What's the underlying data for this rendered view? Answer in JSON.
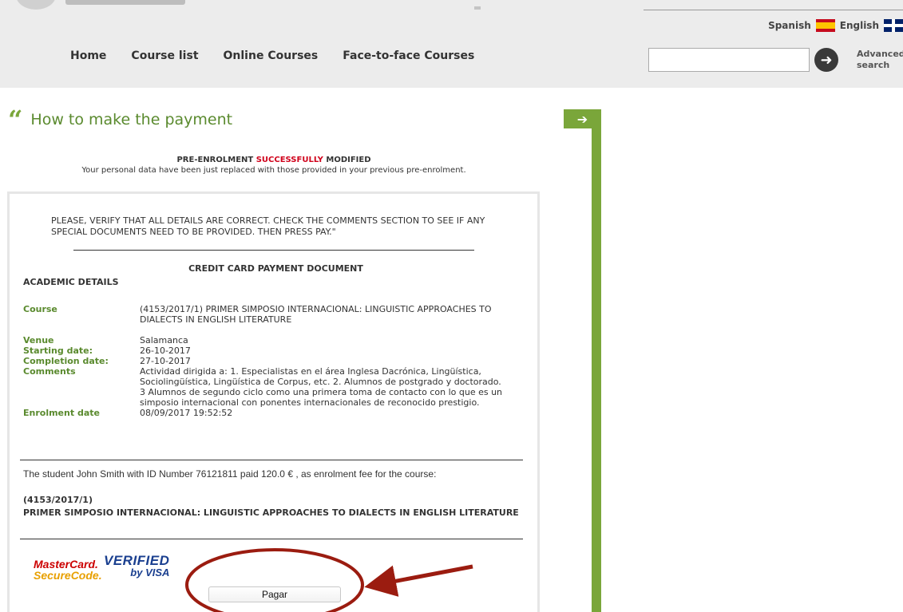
{
  "header": {
    "languages": [
      {
        "label": "Spanish",
        "flag": "spain-flag-icon"
      },
      {
        "label": "English",
        "flag": "uk-flag-icon"
      }
    ],
    "nav": [
      "Home",
      "Course list",
      "Online Courses",
      "Face-to-face Courses"
    ],
    "search": {
      "value": "",
      "advanced_label_line1": "Advanced",
      "advanced_label_line2": "search"
    }
  },
  "page_title": "How to make the payment",
  "confirmation": {
    "prefix": "PRE-ENROLMENT ",
    "highlight": "SUCCESSFULLY",
    "suffix": " MODIFIED",
    "message": "Your personal data have been just replaced with those provided in your previous pre-enrolment."
  },
  "document": {
    "verify_text": "PLEASE, VERIFY THAT ALL DETAILS ARE CORRECT. CHECK THE COMMENTS SECTION TO SEE IF ANY SPECIAL DOCUMENTS NEED TO BE PROVIDED. THEN PRESS PAY.\"",
    "title": "CREDIT CARD PAYMENT DOCUMENT",
    "section": "ACADEMIC DETAILS",
    "details": [
      {
        "label": "Course",
        "value": "(4153/2017/1) PRIMER SIMPOSIO INTERNACIONAL: LINGUISTIC APPROACHES TO DIALECTS IN ENGLISH LITERATURE"
      },
      {
        "label": "Venue",
        "value": "Salamanca"
      },
      {
        "label": "Starting date:",
        "value": "26-10-2017"
      },
      {
        "label": "Completion date:",
        "value": "27-10-2017"
      },
      {
        "label": "Comments",
        "value": "Actividad dirigida a: 1. Especialistas en el área Inglesa Dacrónica, Lingüística, Sociolingüística, Lingüística de Corpus, etc. 2. Alumnos de postgrado y doctorado. 3 Alumnos de segundo ciclo como una primera toma de contacto con lo que es un simposio internacional con ponentes internacionales de reconocido prestigio."
      },
      {
        "label": "Enrolment date",
        "value": "08/09/2017 19:52:52"
      }
    ],
    "student_line": "The student John Smith with ID Number 76121811 paid 120.0 € , as enrolment fee for the course:",
    "course_code": "(4153/2017/1)",
    "course_name": "PRIMER SIMPOSIO INTERNACIONAL: LINGUISTIC APPROACHES TO DIALECTS IN ENGLISH LITERATURE",
    "mastercard_line1": "MasterCard.",
    "mastercard_line2": "SecureCode.",
    "visa_line1": "VERIFIED",
    "visa_line2": "by VISA",
    "pay_button": "Pagar"
  },
  "annotation_color": "#9b1c10",
  "accent_green": "#7aa63a"
}
